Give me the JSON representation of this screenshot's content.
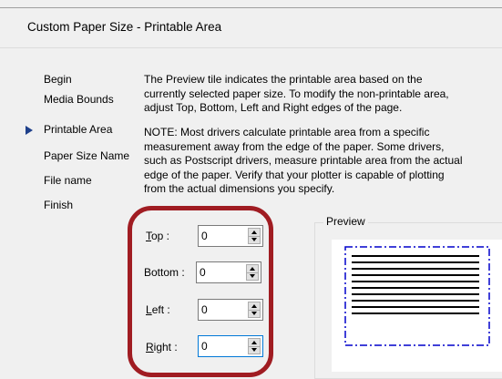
{
  "dialog": {
    "title": "Custom Paper Size - Printable Area"
  },
  "nav": {
    "items": [
      {
        "label": "Begin",
        "current": false
      },
      {
        "label": "Media Bounds",
        "current": false
      },
      {
        "label": "Printable Area",
        "current": true
      },
      {
        "label": "Paper Size Name",
        "current": false
      },
      {
        "label": "File name",
        "current": false
      },
      {
        "label": "Finish",
        "current": false
      }
    ]
  },
  "content": {
    "paragraph1": [
      "The Preview tile indicates the printable area based on the",
      "currently selected paper size. To modify the non-printable area,",
      "adjust Top, Bottom, Left and Right edges of the page."
    ],
    "paragraph2": [
      "NOTE: Most drivers calculate printable area from a specific",
      "measurement away from the edge of the paper. Some drivers,",
      "such as Postscript drivers, measure printable area from the actual",
      "edge of the paper. Verify that your plotter is capable of plotting",
      "from the actual dimensions you specify."
    ]
  },
  "fields": {
    "top": {
      "mnemonic": "T",
      "rest": "op :",
      "value": "0"
    },
    "bottom": {
      "label": "Bottom :",
      "value": "0"
    },
    "left": {
      "mnemonic": "L",
      "rest": "eft :",
      "value": "0"
    },
    "right": {
      "mnemonic": "R",
      "rest": "ight :",
      "value": "0"
    }
  },
  "preview": {
    "label": "Preview",
    "line_count": 10
  },
  "colors": {
    "highlight": "#a01c22",
    "accent": "#0078d7",
    "nav_arrow": "#1e3f8a",
    "printable_border": "#0000cc"
  }
}
